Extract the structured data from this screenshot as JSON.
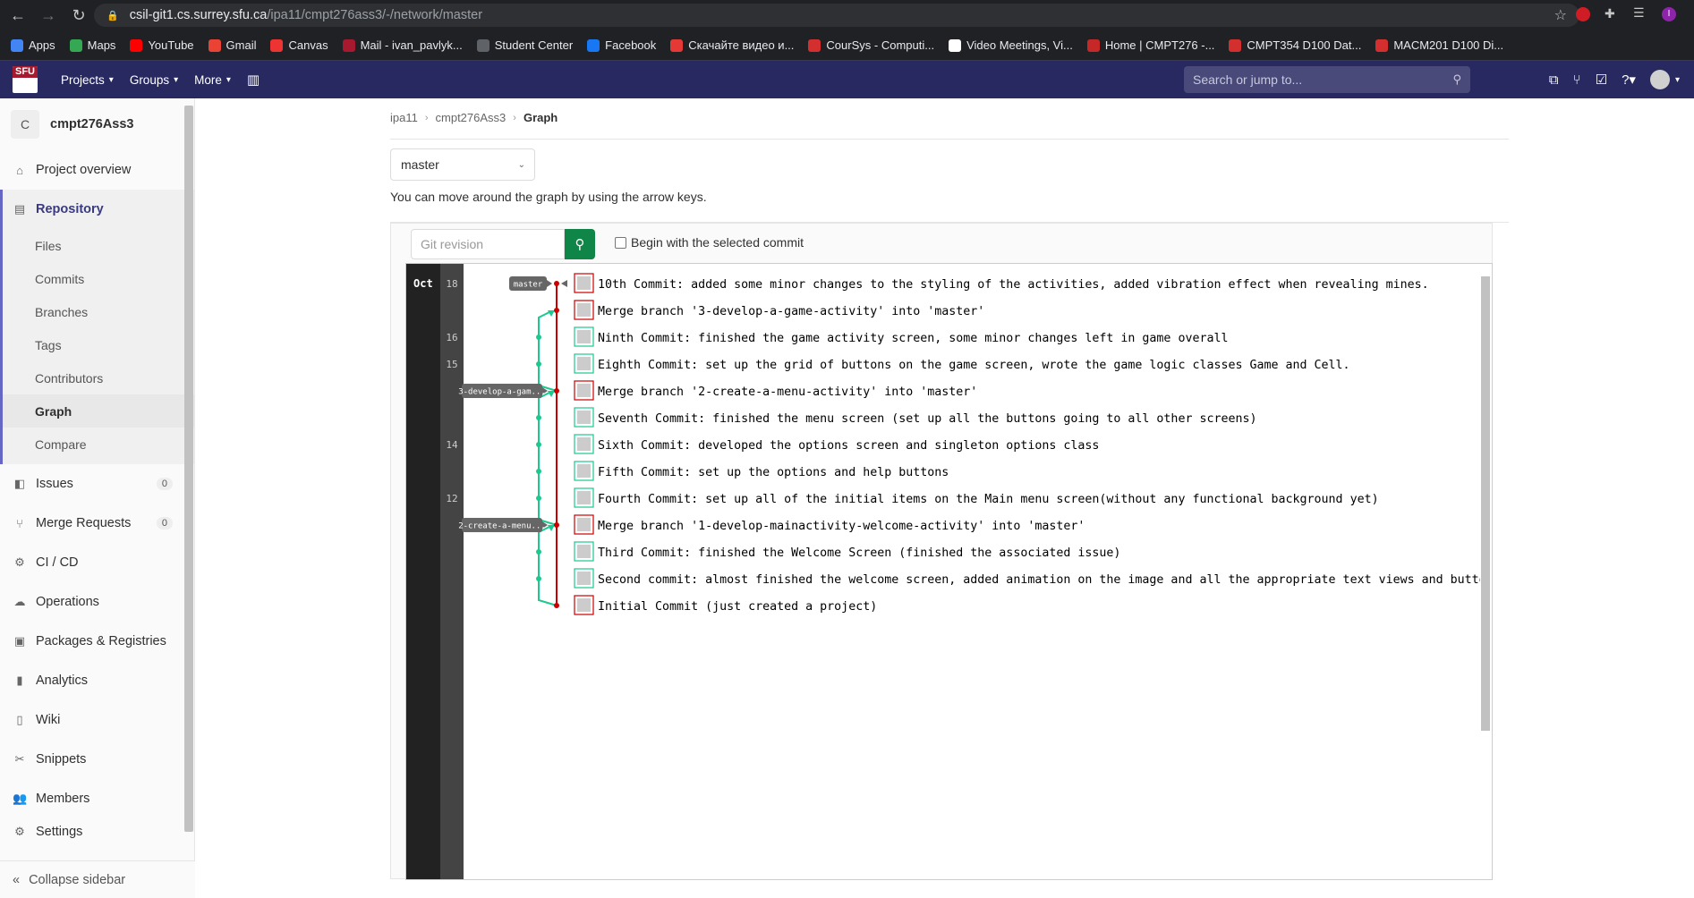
{
  "browser": {
    "url_host": "csil-git1.cs.surrey.sfu.ca",
    "url_path": "/ipa11/cmpt276ass3/-/network/master",
    "bookmarks": [
      "Apps",
      "Maps",
      "YouTube",
      "Gmail",
      "Canvas",
      "Mail - ivan_pavlyk...",
      "Student Center",
      "Facebook",
      "Скачайте видео и...",
      "CourSys - Computi...",
      "Video Meetings, Vi...",
      "Home | CMPT276 -...",
      "CMPT354 D100 Dat...",
      "MACM201 D100 Di..."
    ],
    "profile_initial": "I"
  },
  "topnav": {
    "projects": "Projects",
    "groups": "Groups",
    "more": "More",
    "search_placeholder": "Search or jump to..."
  },
  "sidebar": {
    "project_initial": "C",
    "project_name": "cmpt276Ass3",
    "overview": "Project overview",
    "repository": "Repository",
    "repo_items": [
      "Files",
      "Commits",
      "Branches",
      "Tags",
      "Contributors",
      "Graph",
      "Compare"
    ],
    "active_repo_item": "Graph",
    "issues": "Issues",
    "issues_count": "0",
    "merge_requests": "Merge Requests",
    "mr_count": "0",
    "cicd": "CI / CD",
    "operations": "Operations",
    "packages": "Packages & Registries",
    "analytics": "Analytics",
    "wiki": "Wiki",
    "snippets": "Snippets",
    "members": "Members",
    "settings": "Settings",
    "collapse": "Collapse sidebar"
  },
  "breadcrumb": [
    "ipa11",
    "cmpt276Ass3",
    "Graph"
  ],
  "branch_select": "master",
  "hint": "You can move around the graph by using the arrow keys.",
  "revision_placeholder": "Git revision",
  "begin_checkbox_label": "Begin with the selected commit",
  "graph": {
    "month": "Oct",
    "labels": {
      "master": "master",
      "branch3": "3-develop-a-gam...",
      "branch2": "2-create-a-menu..."
    },
    "commits": [
      {
        "day": "18",
        "message": "10th Commit: added some minor changes to the styling of the activities, added vibration effect when revealing mines."
      },
      {
        "day": "",
        "message": "Merge branch '3-develop-a-game-activity' into 'master'"
      },
      {
        "day": "16",
        "message": "Ninth Commit: finished the game activity screen, some minor changes left in game overall"
      },
      {
        "day": "15",
        "message": "Eighth Commit: set up the grid of buttons on the game screen, wrote the game logic classes Game and Cell."
      },
      {
        "day": "",
        "message": "Merge branch '2-create-a-menu-activity' into 'master'"
      },
      {
        "day": "",
        "message": "Seventh Commit: finished the menu screen (set up all the buttons going to all other screens)"
      },
      {
        "day": "14",
        "message": "Sixth Commit: developed the options screen and singleton options class"
      },
      {
        "day": "",
        "message": "Fifth Commit: set up the options and help buttons"
      },
      {
        "day": "12",
        "message": "Fourth Commit: set up all of the initial items on the Main menu screen(without any functional background yet)"
      },
      {
        "day": "",
        "message": "Merge branch '1-develop-mainactivity-welcome-activity' into 'master'"
      },
      {
        "day": "",
        "message": "Third Commit: finished the Welcome Screen (finished the associated issue)"
      },
      {
        "day": "",
        "message": "Second commit: almost finished the welcome screen, added animation on the image and all the appropriate text views and buttons"
      },
      {
        "day": "",
        "message": "Initial Commit (just created a project)"
      }
    ]
  }
}
